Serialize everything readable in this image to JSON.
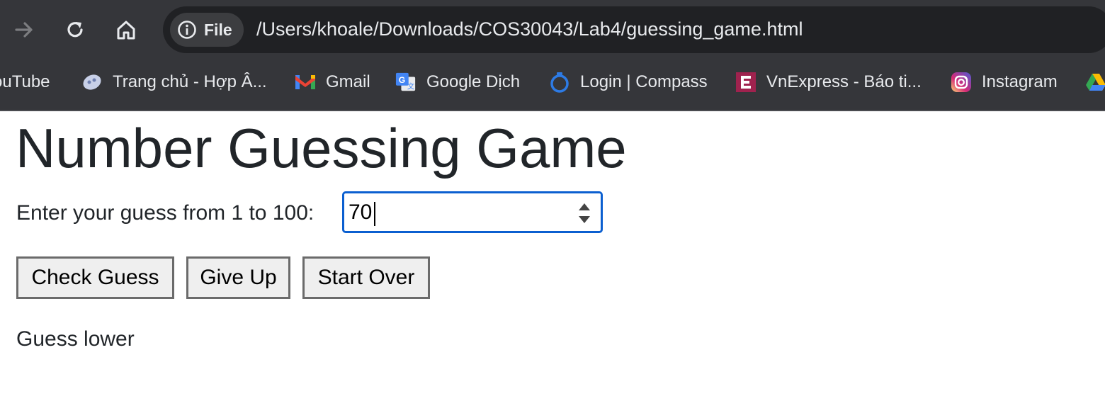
{
  "browser": {
    "site_chip_label": "File",
    "url": "/Users/khoale/Downloads/COS30043/Lab4/guessing_game.html",
    "bookmarks": [
      {
        "label": "ouTube",
        "icon": "youtube-icon"
      },
      {
        "label": "Trang chủ - Hợp Â...",
        "icon": "hop-am-icon"
      },
      {
        "label": "Gmail",
        "icon": "gmail-icon"
      },
      {
        "label": "Google Dịch",
        "icon": "google-translate-icon"
      },
      {
        "label": "Login | Compass",
        "icon": "compass-icon"
      },
      {
        "label": "VnExpress - Báo ti...",
        "icon": "vnexpress-icon"
      },
      {
        "label": "Instagram",
        "icon": "instagram-icon"
      },
      {
        "label": "",
        "icon": "google-drive-icon"
      }
    ]
  },
  "page": {
    "title": "Number Guessing Game",
    "guess_label": "Enter your guess from 1 to 100:",
    "guess_value": "70",
    "buttons": {
      "check": "Check Guess",
      "give_up": "Give Up",
      "start_over": "Start Over"
    },
    "feedback": "Guess lower"
  },
  "colors": {
    "chrome_bg": "#35363a",
    "omnibox_bg": "#202124",
    "input_focus": "#0b5fd0",
    "text": "#212529"
  }
}
